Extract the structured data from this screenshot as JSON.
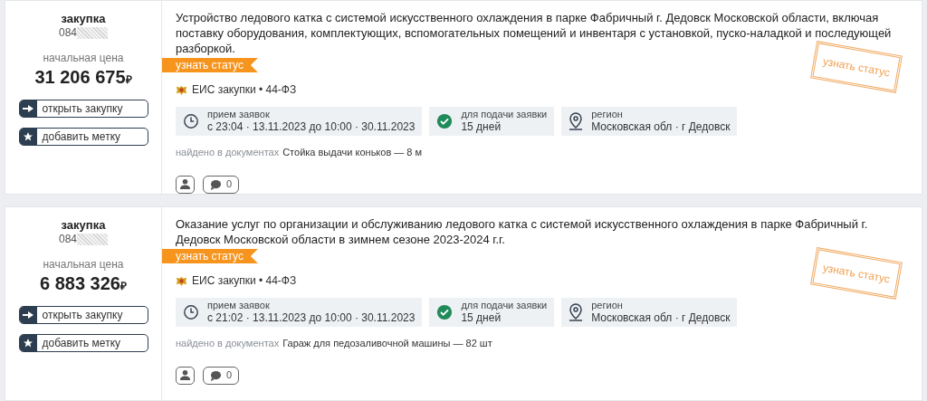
{
  "cards": [
    {
      "type_label": "закупка",
      "number": "084",
      "price_label": "начальная цена",
      "price": "31 206 675",
      "currency": "₽",
      "actions": [
        {
          "kind": "open",
          "label": "открыть закупку"
        },
        {
          "kind": "mark",
          "label": "добавить метку"
        }
      ],
      "title": "Устройство ледового катка с системой искусственного охлаждения в парке Фабричный г. Дедовск Московской области, включая поставку оборудования, комплектующих, вспомогательных помещений и инвентаря с установкой, пуско-наладкой и последующей разборкой.",
      "status_ribbon": "узнать статус",
      "source": "ЕИС закупки • 44-ФЗ",
      "info": [
        {
          "kind": "clock",
          "label": "прием заявок",
          "value": "с 23:04 · 13.11.2023 до 10:00 · 30.11.2023"
        },
        {
          "kind": "check",
          "label": "для подачи заявки",
          "value": "15 дней"
        },
        {
          "kind": "pin",
          "label": "регион",
          "value": "Московская обл · г Дедовск"
        }
      ],
      "found_label": "найдено в документах",
      "found_text": "Стойка выдачи коньков — 8 м",
      "comments": "0",
      "stamp": "узнать статус"
    },
    {
      "type_label": "закупка",
      "number": "084",
      "price_label": "начальная цена",
      "price": "6 883 326",
      "currency": "₽",
      "actions": [
        {
          "kind": "open",
          "label": "открыть закупку"
        },
        {
          "kind": "mark",
          "label": "добавить метку"
        }
      ],
      "title": "Оказание услуг по организации и обслуживанию ледового катка с системой искусственного охлаждения в парке Фабричный г. Дедовск Московской области в зимнем сезоне 2023-2024 г.г.",
      "status_ribbon": "узнать статус",
      "source": "ЕИС закупки • 44-ФЗ",
      "info": [
        {
          "kind": "clock",
          "label": "прием заявок",
          "value": "с 21:02 · 13.11.2023 до 10:00 · 30.11.2023"
        },
        {
          "kind": "check",
          "label": "для подачи заявки",
          "value": "15 дней"
        },
        {
          "kind": "pin",
          "label": "регион",
          "value": "Московская обл · г Дедовск"
        }
      ],
      "found_label": "найдено в документах",
      "found_text": "Гараж для педозаливочной машины — 82 шт",
      "comments": "0",
      "stamp": "узнать статус"
    }
  ]
}
